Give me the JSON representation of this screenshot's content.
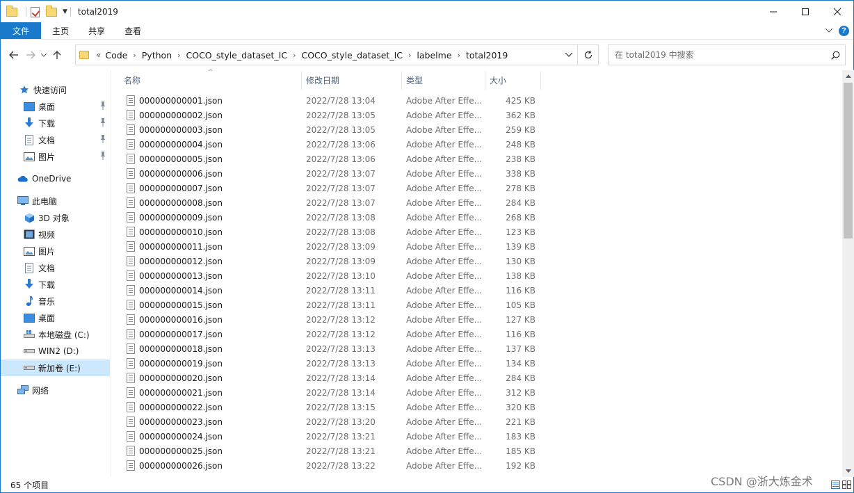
{
  "window": {
    "title": "total2019"
  },
  "ribbon": {
    "tabs": [
      "文件",
      "主页",
      "共享",
      "查看"
    ]
  },
  "address": {
    "prefix": "«",
    "crumbs": [
      "Code",
      "Python",
      "COCO_style_dataset_IC",
      "COCO_style_dataset_IC",
      "labelme",
      "total2019"
    ]
  },
  "search": {
    "placeholder": "在 total2019 中搜索"
  },
  "nav": {
    "items": [
      {
        "label": "快速访问",
        "icon": "star-icon",
        "pinned": false
      },
      {
        "label": "桌面",
        "icon": "desktop-icon",
        "pinned": true
      },
      {
        "label": "下载",
        "icon": "download-icon",
        "pinned": true
      },
      {
        "label": "文档",
        "icon": "document-icon",
        "pinned": true
      },
      {
        "label": "图片",
        "icon": "pictures-icon",
        "pinned": true
      },
      {
        "label": "OneDrive",
        "icon": "cloud-icon",
        "pinned": false
      },
      {
        "label": "此电脑",
        "icon": "computer-icon",
        "pinned": false
      },
      {
        "label": "3D 对象",
        "icon": "cube-icon",
        "pinned": false
      },
      {
        "label": "视频",
        "icon": "video-icon",
        "pinned": false
      },
      {
        "label": "图片",
        "icon": "pictures-icon",
        "pinned": false
      },
      {
        "label": "文档",
        "icon": "document-icon",
        "pinned": false
      },
      {
        "label": "下载",
        "icon": "download-icon",
        "pinned": false
      },
      {
        "label": "音乐",
        "icon": "music-icon",
        "pinned": false
      },
      {
        "label": "桌面",
        "icon": "desktop-icon",
        "pinned": false
      },
      {
        "label": "本地磁盘 (C:)",
        "icon": "windows-drive-icon",
        "pinned": false
      },
      {
        "label": "WIN2 (D:)",
        "icon": "drive-icon",
        "pinned": false
      },
      {
        "label": "新加卷 (E:)",
        "icon": "drive-icon",
        "pinned": false,
        "selected": true
      },
      {
        "label": "网络",
        "icon": "network-icon",
        "pinned": false
      }
    ]
  },
  "columns": {
    "name": "名称",
    "date": "修改日期",
    "type": "类型",
    "size": "大小"
  },
  "files": [
    {
      "name": "000000000001.json",
      "date": "2022/7/28 13:04",
      "type": "Adobe After Effe...",
      "size": "425 KB"
    },
    {
      "name": "000000000002.json",
      "date": "2022/7/28 13:05",
      "type": "Adobe After Effe...",
      "size": "362 KB"
    },
    {
      "name": "000000000003.json",
      "date": "2022/7/28 13:05",
      "type": "Adobe After Effe...",
      "size": "259 KB"
    },
    {
      "name": "000000000004.json",
      "date": "2022/7/28 13:06",
      "type": "Adobe After Effe...",
      "size": "248 KB"
    },
    {
      "name": "000000000005.json",
      "date": "2022/7/28 13:06",
      "type": "Adobe After Effe...",
      "size": "238 KB"
    },
    {
      "name": "000000000006.json",
      "date": "2022/7/28 13:07",
      "type": "Adobe After Effe...",
      "size": "338 KB"
    },
    {
      "name": "000000000007.json",
      "date": "2022/7/28 13:07",
      "type": "Adobe After Effe...",
      "size": "278 KB"
    },
    {
      "name": "000000000008.json",
      "date": "2022/7/28 13:07",
      "type": "Adobe After Effe...",
      "size": "284 KB"
    },
    {
      "name": "000000000009.json",
      "date": "2022/7/28 13:08",
      "type": "Adobe After Effe...",
      "size": "268 KB"
    },
    {
      "name": "000000000010.json",
      "date": "2022/7/28 13:08",
      "type": "Adobe After Effe...",
      "size": "123 KB"
    },
    {
      "name": "000000000011.json",
      "date": "2022/7/28 13:09",
      "type": "Adobe After Effe...",
      "size": "139 KB"
    },
    {
      "name": "000000000012.json",
      "date": "2022/7/28 13:09",
      "type": "Adobe After Effe...",
      "size": "130 KB"
    },
    {
      "name": "000000000013.json",
      "date": "2022/7/28 13:10",
      "type": "Adobe After Effe...",
      "size": "138 KB"
    },
    {
      "name": "000000000014.json",
      "date": "2022/7/28 13:11",
      "type": "Adobe After Effe...",
      "size": "116 KB"
    },
    {
      "name": "000000000015.json",
      "date": "2022/7/28 13:11",
      "type": "Adobe After Effe...",
      "size": "105 KB"
    },
    {
      "name": "000000000016.json",
      "date": "2022/7/28 13:12",
      "type": "Adobe After Effe...",
      "size": "127 KB"
    },
    {
      "name": "000000000017.json",
      "date": "2022/7/28 13:12",
      "type": "Adobe After Effe...",
      "size": "116 KB"
    },
    {
      "name": "000000000018.json",
      "date": "2022/7/28 13:13",
      "type": "Adobe After Effe...",
      "size": "137 KB"
    },
    {
      "name": "000000000019.json",
      "date": "2022/7/28 13:13",
      "type": "Adobe After Effe...",
      "size": "134 KB"
    },
    {
      "name": "000000000020.json",
      "date": "2022/7/28 13:14",
      "type": "Adobe After Effe...",
      "size": "284 KB"
    },
    {
      "name": "000000000021.json",
      "date": "2022/7/28 13:14",
      "type": "Adobe After Effe...",
      "size": "312 KB"
    },
    {
      "name": "000000000022.json",
      "date": "2022/7/28 13:15",
      "type": "Adobe After Effe...",
      "size": "320 KB"
    },
    {
      "name": "000000000023.json",
      "date": "2022/7/28 13:20",
      "type": "Adobe After Effe...",
      "size": "221 KB"
    },
    {
      "name": "000000000024.json",
      "date": "2022/7/28 13:21",
      "type": "Adobe After Effe...",
      "size": "183 KB"
    },
    {
      "name": "000000000025.json",
      "date": "2022/7/28 13:21",
      "type": "Adobe After Effe...",
      "size": "185 KB"
    },
    {
      "name": "000000000026.json",
      "date": "2022/7/28 13:22",
      "type": "Adobe After Effe...",
      "size": "192 KB"
    }
  ],
  "status": {
    "item_count": "65 个项目"
  },
  "watermark": "CSDN @浙大炼金术",
  "colors": {
    "accent": "#1979ca",
    "selected": "#cce8ff",
    "header_text": "#4c607a",
    "secondary_text": "#6d6d6d"
  }
}
